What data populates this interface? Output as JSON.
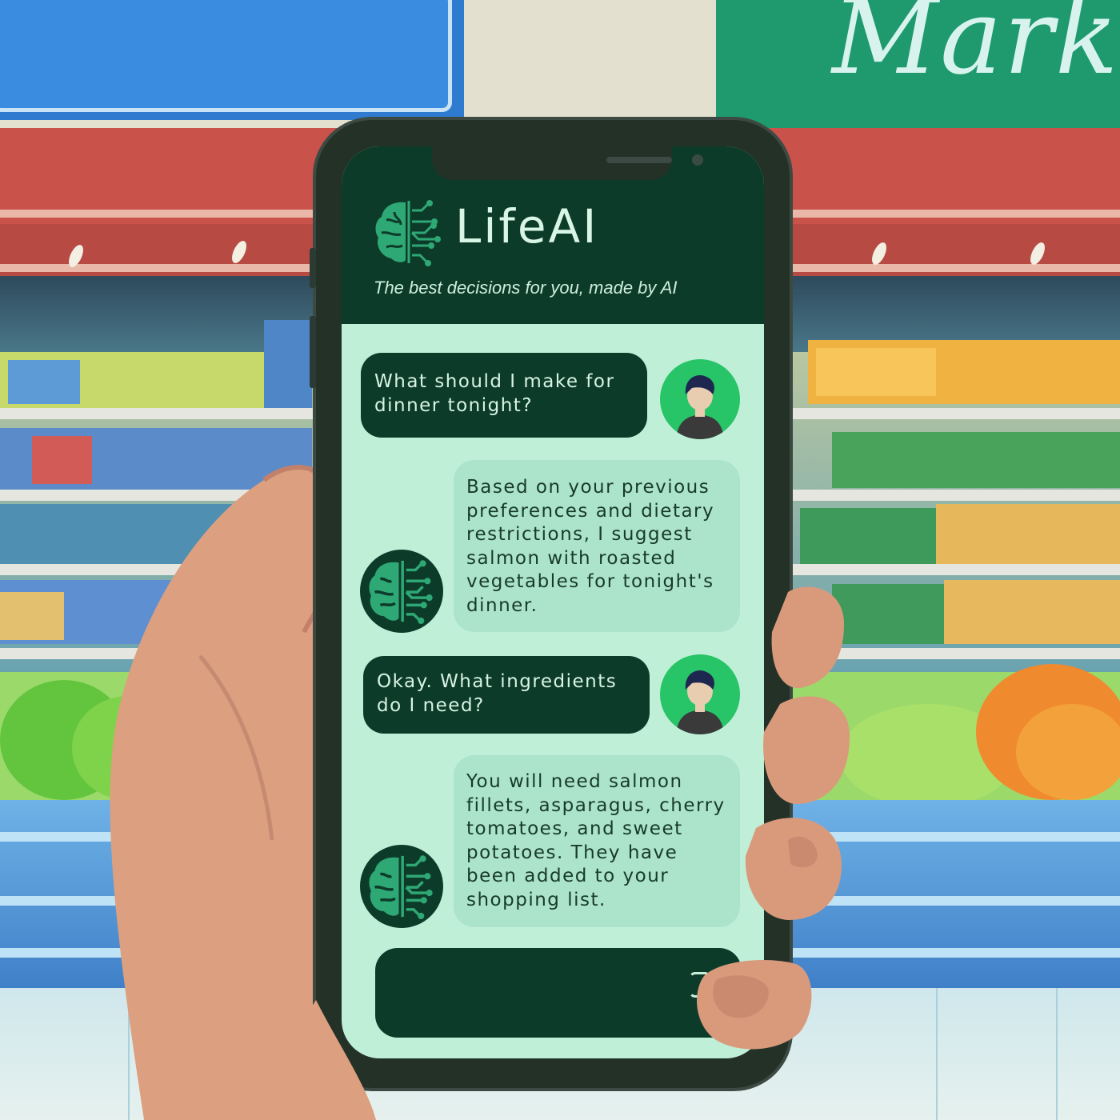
{
  "background": {
    "store_sign_text": "Mark"
  },
  "app": {
    "title": "LifeAI",
    "tagline": "The best decisions for you, made by AI",
    "logo_icon": "brain-circuit-icon"
  },
  "messages": [
    {
      "role": "user",
      "text": "What should I make for dinner tonight?",
      "avatar": "user-avatar-icon"
    },
    {
      "role": "ai",
      "text": "Based on your previous preferences and dietary restrictions, I suggest salmon with roasted vegetables for tonight's dinner.",
      "avatar": "brain-circuit-icon"
    },
    {
      "role": "user",
      "text": "Okay. What ingredients do I need?",
      "avatar": "user-avatar-icon"
    },
    {
      "role": "ai",
      "text": "You will need salmon fillets, asparagus, cherry tomatoes, and sweet potatoes. They have been added to your shopping list.",
      "avatar": "brain-circuit-icon"
    }
  ],
  "input": {
    "placeholder": ""
  },
  "colors": {
    "header": "#0d3b2a",
    "screen_bg": "#c0efd7",
    "ai_bubble": "#ace3cb",
    "user_avatar_bg": "#27c468",
    "brain_icon": "#2ea874"
  }
}
